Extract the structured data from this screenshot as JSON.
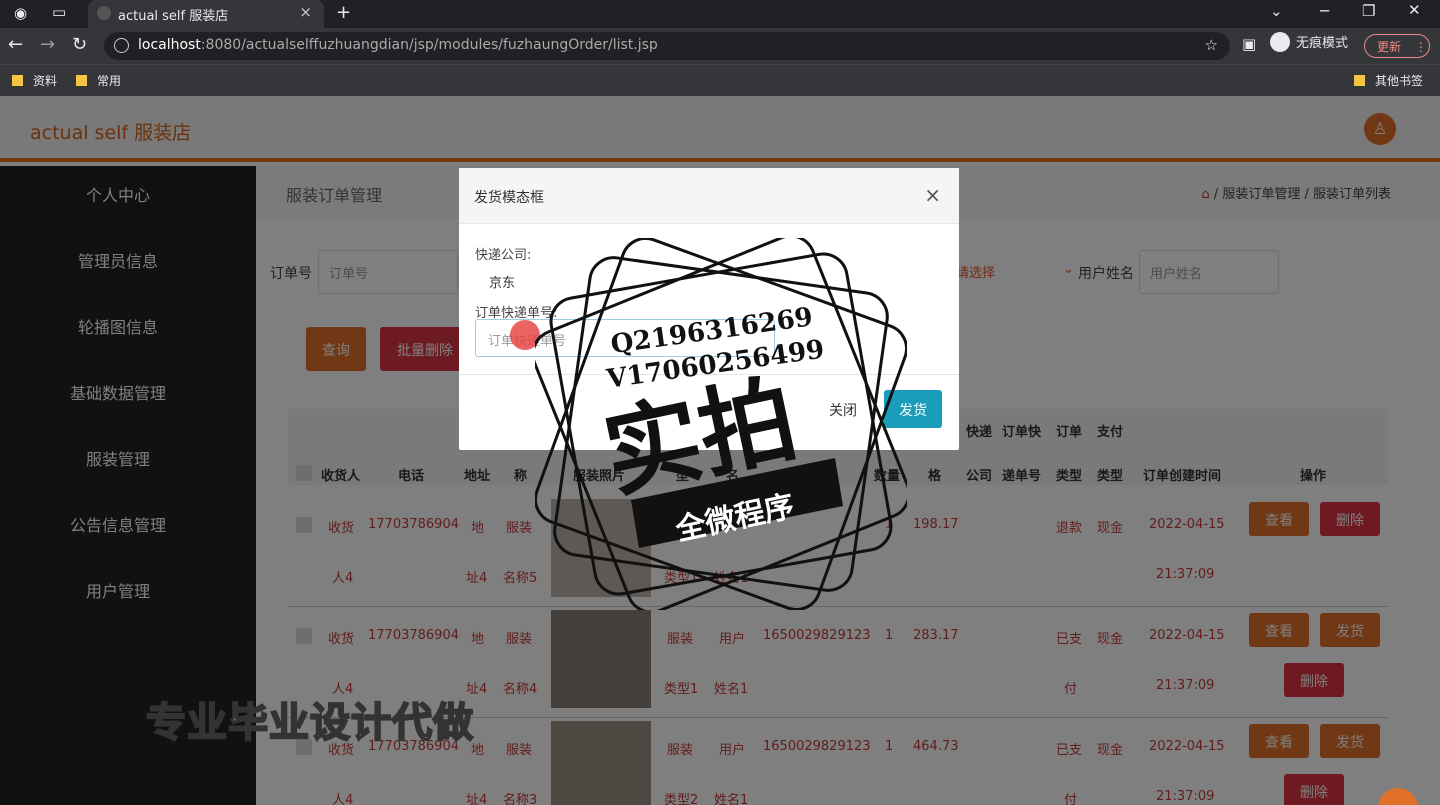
{
  "browser": {
    "tab_title": "actual self 服装店",
    "url_host": "localhost",
    "url_rest": ":8080/actualselffuzhuangdian/jsp/modules/fuzhaungOrder/list.jsp",
    "incognito_label": "无痕模式",
    "update_label": "更新",
    "bookmarks": [
      "资料",
      "常用"
    ],
    "other_bookmarks": "其他书签"
  },
  "app": {
    "brand": "actual self 服装店",
    "sidebar": [
      "个人中心",
      "管理员信息",
      "轮播图信息",
      "基础数据管理",
      "服装管理",
      "公告信息管理",
      "用户管理"
    ]
  },
  "main": {
    "page_title": "服装订单管理",
    "breadcrumb": [
      "服装订单管理",
      "服装订单列表"
    ],
    "search": {
      "order_label": "订单号",
      "order_placeholder": "订单号",
      "select_placeholder": "请选择",
      "user_label": "用户姓名",
      "user_placeholder": "用户姓名"
    },
    "buttons": {
      "query": "查询",
      "batch_delete": "批量删除"
    },
    "table": {
      "headers_top": [
        "快递",
        "订单快",
        "订单",
        "支付"
      ],
      "headers": [
        "收货人",
        "电话",
        "地址",
        "称",
        "服装照片",
        "型",
        "名",
        "数量",
        "格",
        "公司",
        "递单号",
        "类型",
        "类型",
        "订单创建时间",
        "操作"
      ],
      "rows": [
        {
          "recv": "收货",
          "recv2": "人4",
          "phone": "17703786904",
          "addr": "地",
          "addr2": "址4",
          "name": "服装",
          "name2": "名称5",
          "type2": "类型1",
          "uname": "姓名1",
          "qty": "1",
          "price": "198.17",
          "status": "退款",
          "pay": "现金",
          "date": "2022-04-15",
          "time": "21:37:09",
          "btn1": "查看",
          "btn2": "删除"
        },
        {
          "recv": "收货",
          "recv2": "人4",
          "phone": "17703786904",
          "addr": "地",
          "addr2": "址4",
          "name": "服装",
          "name2": "名称4",
          "type1": "服装",
          "type2": "类型1",
          "user1": "用户",
          "uname": "姓名1",
          "orderno": "1650029829123",
          "qty": "1",
          "price": "283.17",
          "status": "已支",
          "status2": "付",
          "pay": "现金",
          "date": "2022-04-15",
          "time": "21:37:09",
          "btn1": "查看",
          "btn2": "发货",
          "btn3": "删除"
        },
        {
          "recv": "收货",
          "recv2": "人4",
          "phone": "17703786904",
          "addr": "地",
          "addr2": "址4",
          "name": "服装",
          "name2": "名称3",
          "type1": "服装",
          "type2": "类型2",
          "user1": "用户",
          "uname": "姓名1",
          "orderno": "1650029829123",
          "qty": "1",
          "price": "464.73",
          "status": "已支",
          "status2": "付",
          "pay": "现金",
          "date": "2022-04-15",
          "time": "21:37:09",
          "btn1": "查看",
          "btn2": "发货",
          "btn3": "删除"
        }
      ]
    }
  },
  "modal": {
    "title": "发货模态框",
    "courier_label": "快递公司:",
    "courier_value": "京东",
    "tracking_label": "订单快递单号:",
    "tracking_placeholder": "订单快递单号",
    "close_label": "关闭",
    "ship_label": "发货"
  },
  "watermark": {
    "qq": "Q2196316269",
    "vx": "V17060256499",
    "big": "实拍",
    "ribbon": "全微程序",
    "bottom": "专业毕业设计代做"
  }
}
